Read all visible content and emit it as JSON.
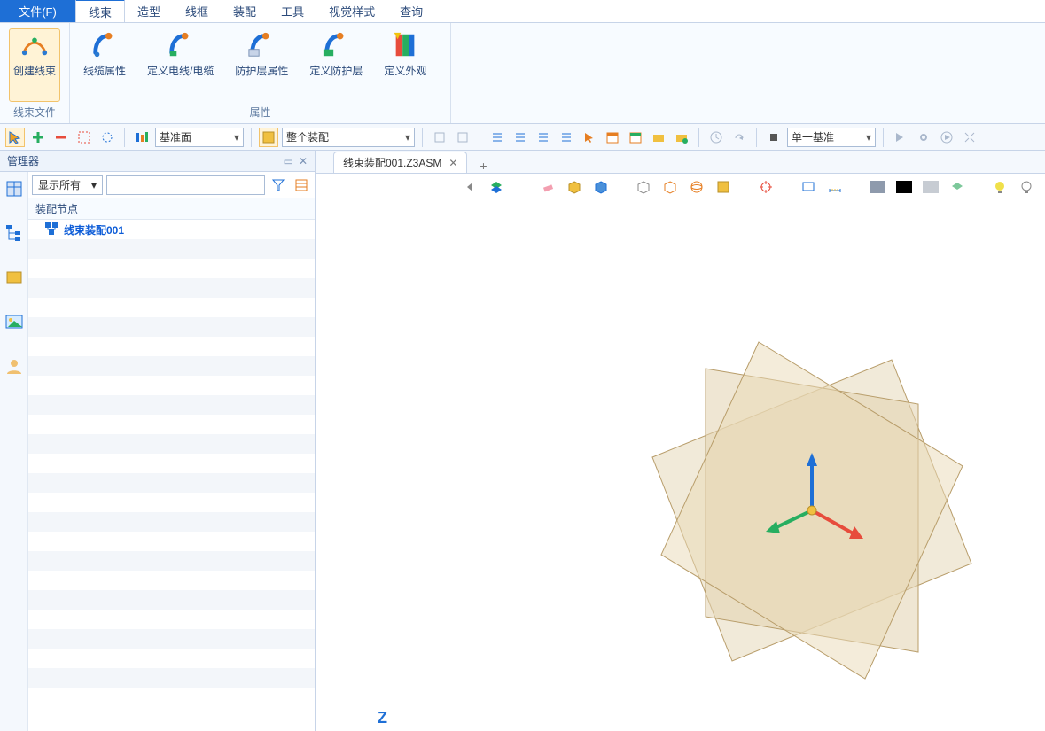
{
  "menu": {
    "file": "文件(F)",
    "tabs": [
      "线束",
      "造型",
      "线框",
      "装配",
      "工具",
      "视觉样式",
      "查询"
    ],
    "active": "线束"
  },
  "ribbon": {
    "groups": [
      {
        "label": "线束文件",
        "buttons": [
          {
            "name": "create-harness",
            "label": "创建线束",
            "icon": "harness",
            "selected": true
          }
        ]
      },
      {
        "label": "属性",
        "buttons": [
          {
            "name": "cable-attr",
            "label": "线缆属性",
            "icon": "cable1"
          },
          {
            "name": "define-wire",
            "label": "定义电线/电缆",
            "icon": "cable2"
          },
          {
            "name": "shield-attr",
            "label": "防护层属性",
            "icon": "cable3"
          },
          {
            "name": "define-shield",
            "label": "定义防护层",
            "icon": "cable4"
          },
          {
            "name": "define-look",
            "label": "定义外观",
            "icon": "swatch"
          }
        ]
      }
    ]
  },
  "qbar": {
    "select1": "基准面",
    "select2": "整个装配",
    "select3": "单一基准"
  },
  "manager": {
    "title": "管理器",
    "filter_label": "显示所有",
    "tree_header": "装配节点",
    "root_label": "线束装配001"
  },
  "doc_tab": "线束装配001.Z3ASM",
  "axis_label": "Z",
  "colors": {
    "accent": "#1e6fd6",
    "plane_fill": "#d8c7a1",
    "plane_stroke": "#b89d6a"
  }
}
